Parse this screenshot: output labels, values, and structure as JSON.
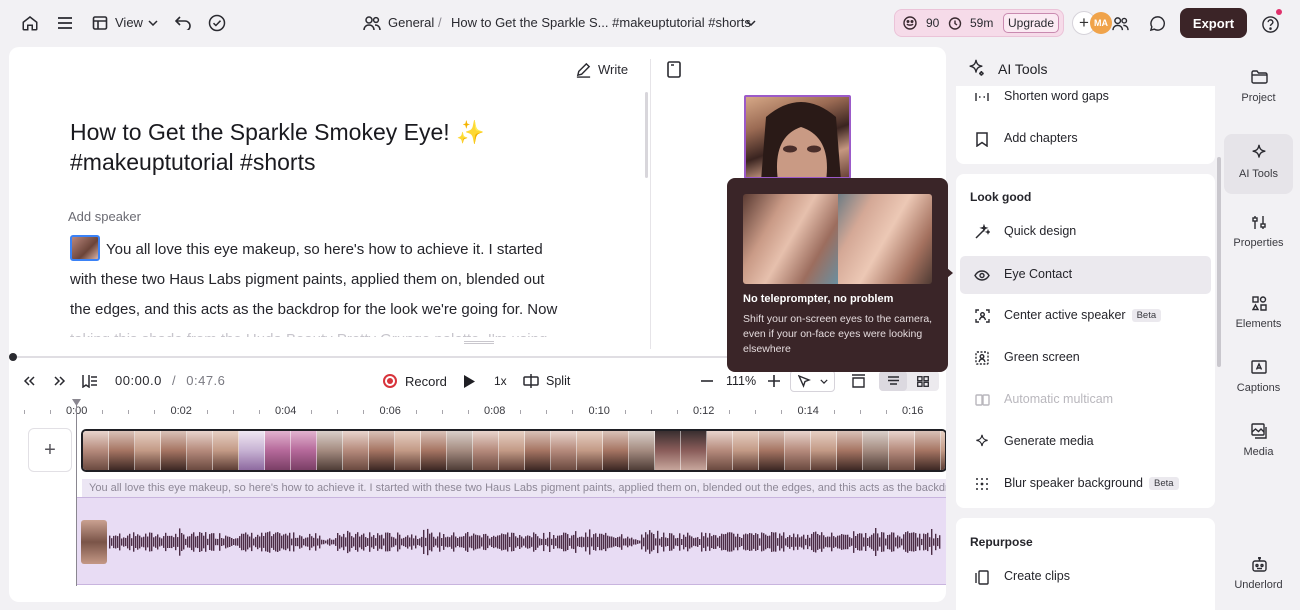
{
  "topbar": {
    "view_label": "View",
    "workspace": "General",
    "separator": "/",
    "project_title": "How to Get the Sparkle S... #makeuptutorial #shorts",
    "credits_value": "90",
    "time_remaining": "59m",
    "upgrade_label": "Upgrade",
    "avatar_initials": "MA",
    "export_label": "Export"
  },
  "editor": {
    "write_label": "Write",
    "title": "How to Get the Sparkle Smokey Eye! ✨ #makeuptutorial #shorts",
    "add_speaker": "Add speaker",
    "transcript_lines": [
      "You all love this eye makeup, so here's how to achieve it. I started",
      "with these two Haus Labs pigment paints, applied them on, blended out",
      "the edges, and this acts as the backdrop for the look we're going for. Now",
      "taking this shade from the Huda Beauty Pretty Grunge palette, I'm using"
    ]
  },
  "playback": {
    "current_time": "00:00.0",
    "time_separator": "/",
    "duration": "0:47.6",
    "record_label": "Record",
    "speed": "1x",
    "split_label": "Split",
    "zoom": "111%"
  },
  "timeline": {
    "ruler_labels": [
      "0:00",
      "0:02",
      "0:04",
      "0:06",
      "0:08",
      "0:10",
      "0:12",
      "0:14",
      "0:16"
    ],
    "add_track_label": "+",
    "caption_text": "You all love this eye makeup, so here's how to achieve it. I started with these two Haus Labs pigment paints, applied them on, blended out the edges, and this acts as the backdrop for the look we're going for."
  },
  "tooltip": {
    "title": "No teleprompter, no problem",
    "body": "Shift your on-screen eyes to the camera, even if your on-face eyes were looking elsewhere"
  },
  "ai_panel": {
    "title": "AI Tools",
    "top_items": [
      {
        "label": "Shorten word gaps",
        "icon": "word-gaps-icon"
      },
      {
        "label": "Add chapters",
        "icon": "bookmark-icon"
      }
    ],
    "look_good": {
      "heading": "Look good",
      "items": [
        {
          "label": "Quick design",
          "icon": "wand-icon"
        },
        {
          "label": "Eye Contact",
          "icon": "eye-icon"
        },
        {
          "label": "Center active speaker",
          "icon": "center-frame-icon",
          "badge": "Beta"
        },
        {
          "label": "Green screen",
          "icon": "green-screen-icon"
        },
        {
          "label": "Automatic multicam",
          "icon": "multicam-icon"
        },
        {
          "label": "Generate media",
          "icon": "sparkle-icon"
        },
        {
          "label": "Blur speaker background",
          "icon": "blur-icon",
          "badge": "Beta"
        }
      ]
    },
    "repurpose": {
      "heading": "Repurpose",
      "items": [
        {
          "label": "Create clips",
          "icon": "clips-icon"
        }
      ]
    }
  },
  "sidebar": {
    "items": [
      {
        "label": "Project",
        "icon": "folder-icon"
      },
      {
        "label": "AI Tools",
        "icon": "sparkle-icon"
      },
      {
        "label": "Properties",
        "icon": "sliders-icon"
      },
      {
        "label": "Elements",
        "icon": "elements-icon"
      },
      {
        "label": "Captions",
        "icon": "captions-icon"
      },
      {
        "label": "Media",
        "icon": "media-icon"
      },
      {
        "label": "Underlord",
        "icon": "robot-icon"
      }
    ]
  },
  "colors": {
    "accent_purple": "#9b5ac9",
    "export_bg": "#3b2427",
    "tooltip_bg": "#3a2528",
    "credits_bg": "#f6dbe9",
    "record_red": "#d8343c",
    "audio_track": "#e8dcf4"
  }
}
